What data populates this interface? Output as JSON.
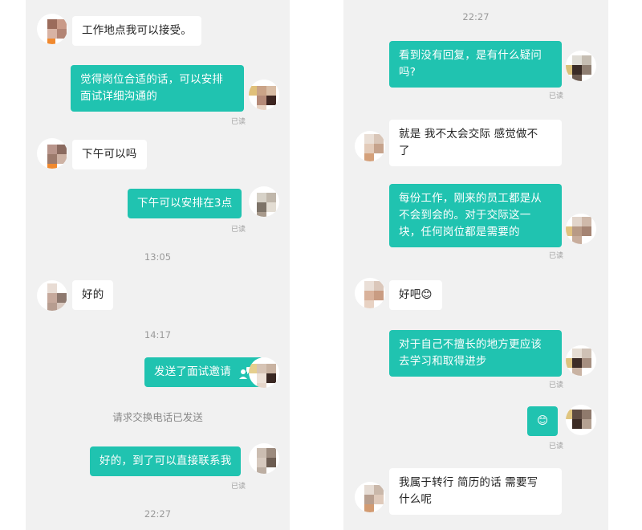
{
  "left": {
    "messages": [
      {
        "side": "in",
        "text": "工作地点我可以接受。"
      },
      {
        "side": "out",
        "text": "觉得岗位合适的话，可以安排\n面试详细沟通的",
        "read": "已读"
      },
      {
        "side": "in",
        "text": "下午可以吗"
      },
      {
        "side": "out",
        "text": "下午可以安排在3点",
        "read": "已读"
      },
      {
        "timestamp": "13:05"
      },
      {
        "side": "in",
        "text": "好的"
      },
      {
        "timestamp": "14:17"
      },
      {
        "side": "out",
        "text": "发送了面试邀请",
        "icon": "interview-invite-icon"
      },
      {
        "system": "请求交换电话已发送"
      },
      {
        "side": "out",
        "text": "好的，到了可以直接联系我",
        "read": "已读"
      },
      {
        "timestamp": "22:27"
      }
    ]
  },
  "right": {
    "messages": [
      {
        "timestamp": "22:27"
      },
      {
        "side": "out",
        "text": "看到没有回复，是有什么疑问\n吗?",
        "read": "已读"
      },
      {
        "side": "in",
        "text": "就是 我不太会交际    感觉做不\n了"
      },
      {
        "side": "out",
        "text": "每份工作，刚来的员工都是从\n不会到会的。对于交际这一\n块，任何岗位都是需要的",
        "read": "已读"
      },
      {
        "side": "in",
        "text": "好吧😊"
      },
      {
        "side": "out",
        "text": "对于自己不擅长的地方更应该\n去学习和取得进步",
        "read": "已读"
      },
      {
        "side": "out",
        "text": "😊",
        "read": "已读"
      },
      {
        "side": "in",
        "text": "我属于转行  简历的话 需要写\n什么呢"
      }
    ]
  },
  "colors": {
    "accent": "#20c3b0",
    "background": "#f1f1f1",
    "incoming": "#ffffff"
  }
}
